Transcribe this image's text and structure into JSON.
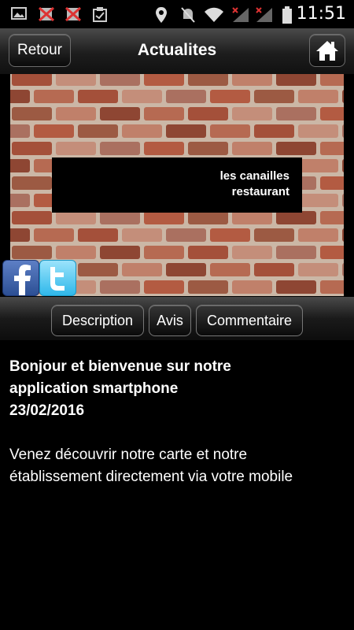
{
  "status_bar": {
    "time": "11:51",
    "icons": [
      "image-icon",
      "no-sim-icon",
      "no-sim-icon",
      "clipboard-icon",
      "location-icon",
      "mute-icon",
      "wifi-icon",
      "signal-icon",
      "signal-icon",
      "battery-icon"
    ]
  },
  "nav": {
    "back_label": "Retour",
    "title": "Actualites",
    "home_icon": "home-icon"
  },
  "banner": {
    "line1": "les canailles",
    "line2": "restaurant",
    "social": [
      "facebook-icon",
      "twitter-icon"
    ]
  },
  "tabs": [
    {
      "label": "Description"
    },
    {
      "label": "Avis"
    },
    {
      "label": "Commentaire"
    }
  ],
  "content": {
    "headline_line1": "Bonjour et bienvenue sur notre",
    "headline_line2": "application smartphone",
    "date": "23/02/2016",
    "body": "Venez découvrir notre carte et notre établissement directement via votre mobile"
  },
  "colors": {
    "background": "#000000",
    "brick": "#9c5a43",
    "facebook": "#3b5998",
    "twitter": "#33bbe8"
  }
}
